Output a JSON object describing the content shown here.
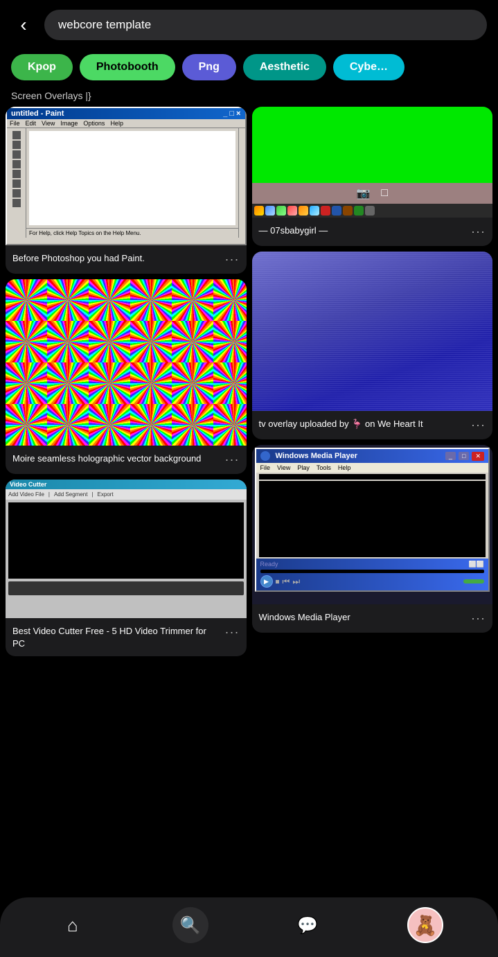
{
  "header": {
    "back_label": "‹",
    "search_value": "webcore template"
  },
  "filters": [
    {
      "id": "kpop",
      "label": "Kpop",
      "class": "pill-kpop"
    },
    {
      "id": "photobooth",
      "label": "Photobooth",
      "class": "pill-photobooth"
    },
    {
      "id": "png",
      "label": "Png",
      "class": "pill-png"
    },
    {
      "id": "aesthetic",
      "label": "Aesthetic",
      "class": "pill-aesthetic"
    },
    {
      "id": "cyber",
      "label": "Cybe…",
      "class": "pill-cyber"
    }
  ],
  "section_label": "Screen Overlays |}",
  "cards_left": [
    {
      "id": "paint",
      "title": "Before Photoshop you had Paint.",
      "subtitle": "",
      "more": "···"
    },
    {
      "id": "moire",
      "title": "Moire seamless holographic vector background",
      "subtitle": "",
      "more": "···"
    },
    {
      "id": "videocutter",
      "title": "Best Video Cutter Free - 5 HD Video Trimmer for PC",
      "subtitle": "",
      "more": "···"
    }
  ],
  "cards_right": [
    {
      "id": "greenscreen",
      "title": "— 07sbabygirl —",
      "subtitle": "",
      "more": "···"
    },
    {
      "id": "tv",
      "title": "tv overlay uploaded by 🦩 on We Heart It",
      "subtitle": "",
      "more": "···"
    },
    {
      "id": "wmp",
      "title": "Windows Media Player",
      "subtitle": "",
      "more": "···"
    }
  ],
  "wmp": {
    "title": "Windows Media Player",
    "menu": [
      "File",
      "View",
      "Play",
      "Tools",
      "Help"
    ],
    "status": "Ready"
  },
  "paint": {
    "title": "untitled - Paint",
    "menu": [
      "File",
      "Edit",
      "View",
      "Image",
      "Options",
      "Help"
    ],
    "help_text": "For Help, click Help Topics on the Help Menu."
  },
  "vc": {
    "title": "Video Cutter",
    "toolbar": [
      "Add Video File",
      "Add Segment",
      "Export"
    ]
  },
  "nav": {
    "home_icon": "⌂",
    "search_icon": "⌕",
    "messages_icon": "💬",
    "avatar_icon": "🧸"
  }
}
